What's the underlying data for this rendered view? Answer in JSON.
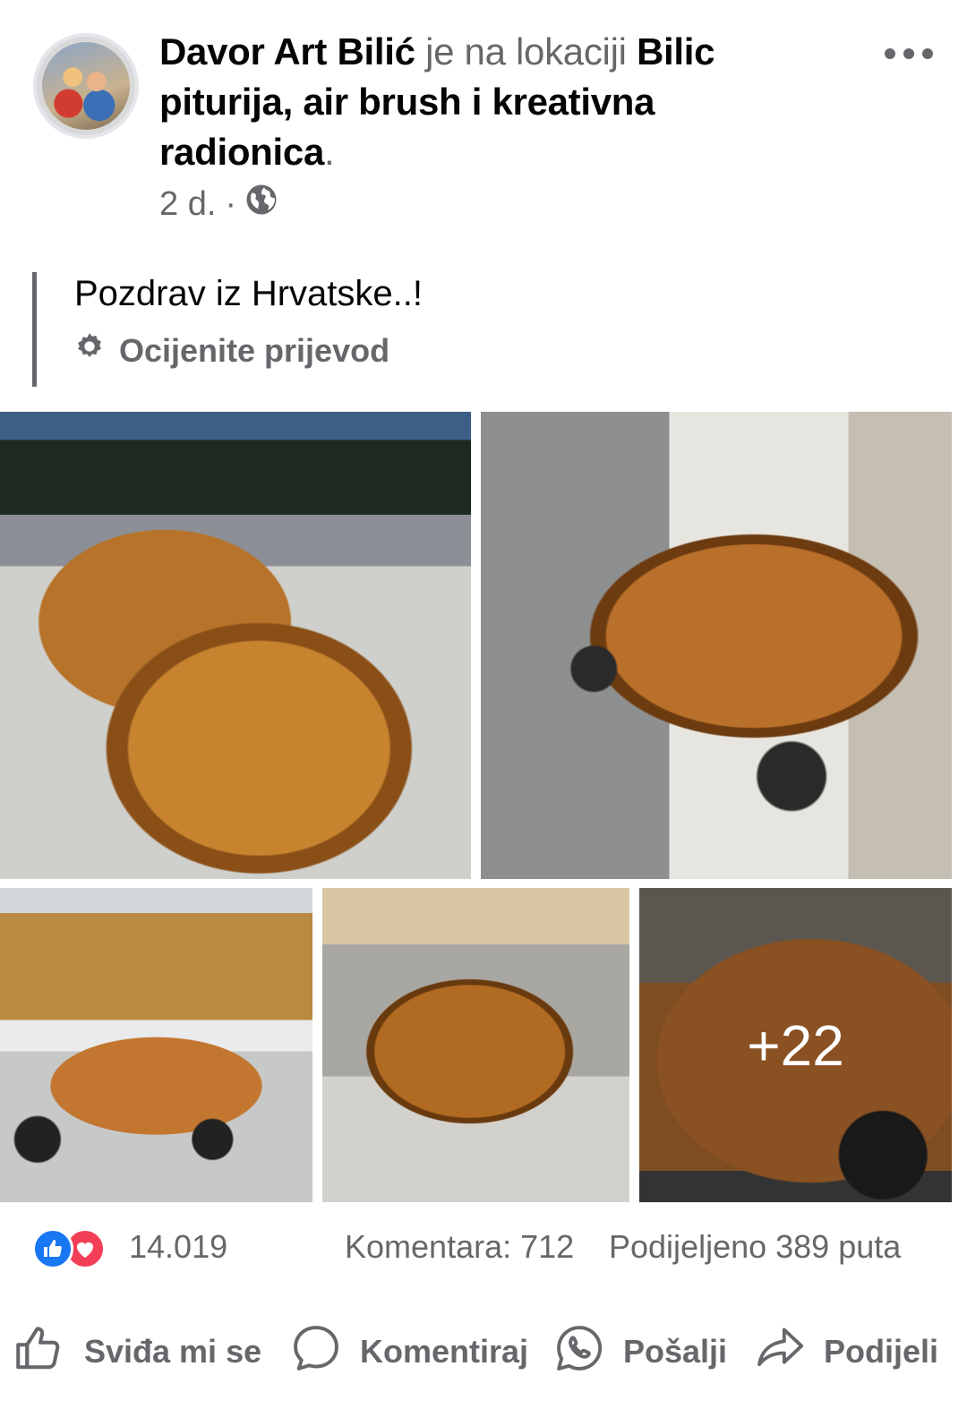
{
  "post": {
    "author": "Davor Art Bilić",
    "location_connector": "je na lokaciji",
    "location_name": "Bilic piturija, air brush i kreativna radionica",
    "location_end": ".",
    "time": "2 d.",
    "separator": "·",
    "privacy_icon": "globe-icon",
    "text": "Pozdrav iz Hrvatske..!",
    "translate_label": "Ocijenite prijevod",
    "more_icon": "more-dots-icon"
  },
  "photos": {
    "more_count": "+22"
  },
  "stats": {
    "reactions_count": "14.019",
    "comments": "Komentara: 712",
    "shares": "Podijeljeno 389 puta"
  },
  "actions": {
    "like": "Sviđa mi se",
    "comment": "Komentiraj",
    "send": "Pošalji",
    "share": "Podijeli"
  },
  "colors": {
    "like_blue": "#1877f2",
    "love_red": "#f33e58",
    "secondary_text": "#65676b"
  }
}
